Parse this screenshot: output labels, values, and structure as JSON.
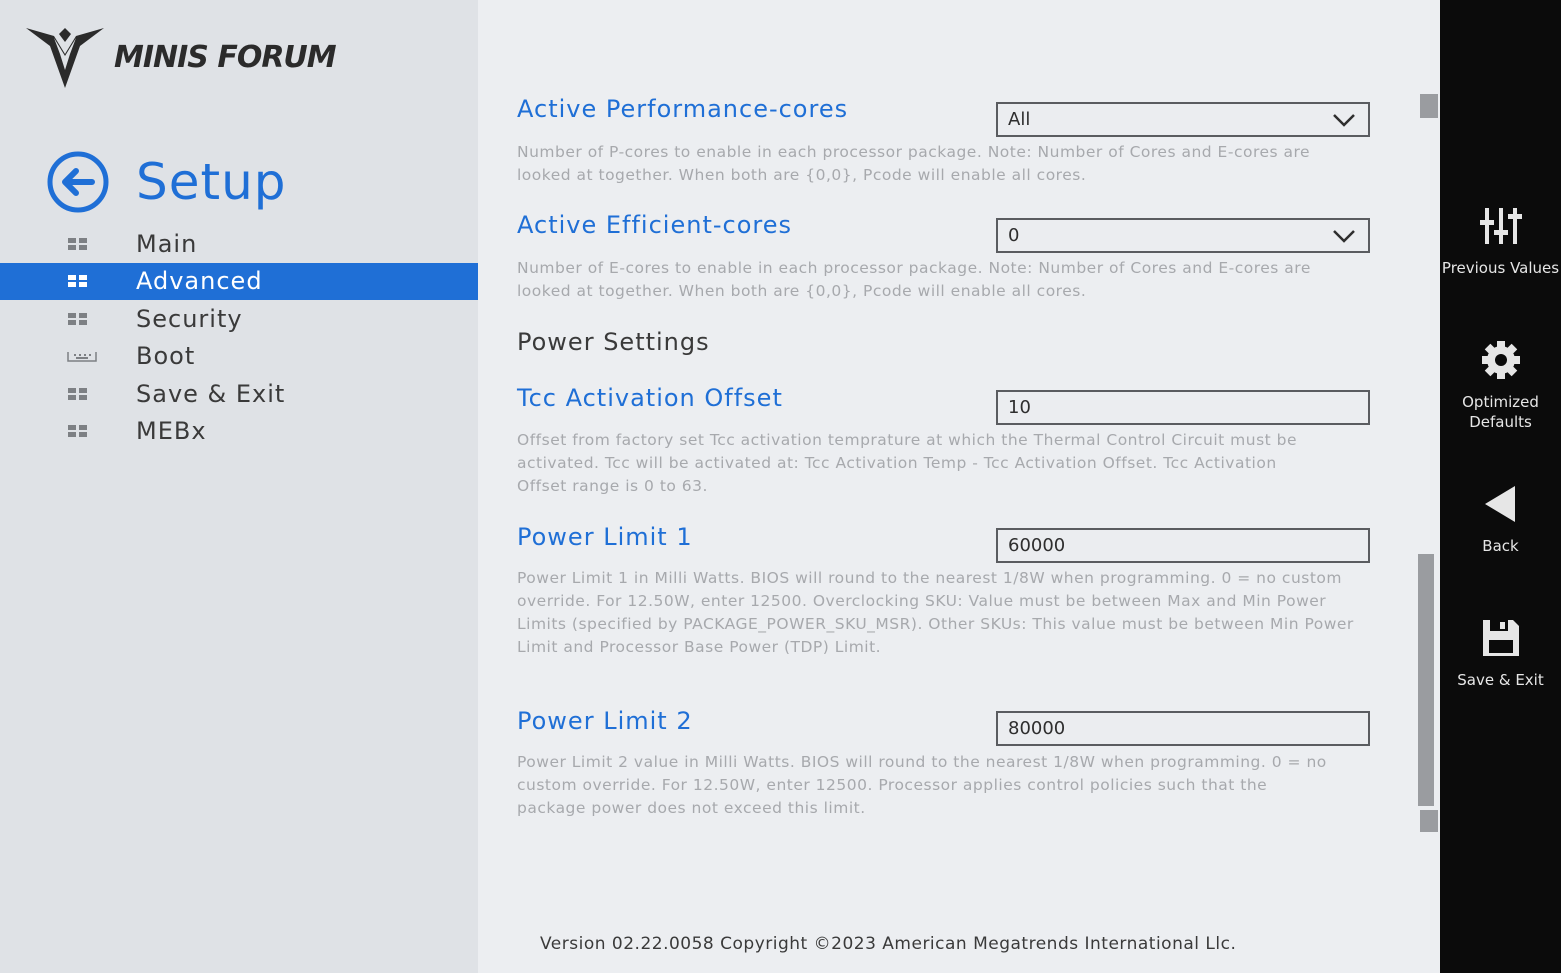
{
  "brand": {
    "logo_text": "MINIS FORUM"
  },
  "header": {
    "title": "Setup"
  },
  "sidebar": {
    "items": [
      {
        "label": "Main"
      },
      {
        "label": "Advanced"
      },
      {
        "label": "Security"
      },
      {
        "label": "Boot"
      },
      {
        "label": "Save & Exit"
      },
      {
        "label": "MEBx"
      }
    ],
    "selected": "Advanced"
  },
  "settings": {
    "p_cores": {
      "label": "Active Performance-cores",
      "value": "All",
      "help": "Number of P-cores to enable in each processor package. Note: Number of Cores and E-cores are looked at together. When both are {0,0}, Pcode will enable all cores."
    },
    "e_cores": {
      "label": "Active Efficient-cores",
      "value": "0",
      "help": "Number of E-cores to enable in each processor package. Note: Number of Cores and E-cores are looked at together. When both are {0,0}, Pcode will enable all cores."
    },
    "power_section": "Power Settings",
    "tcc": {
      "label": "Tcc Activation Offset",
      "value": "10",
      "help": "Offset from factory set Tcc activation temprature at which the Thermal Control Circuit must be activated. Tcc will be activated at: Tcc Activation Temp - Tcc Activation Offset. Tcc Activation Offset range is 0 to 63."
    },
    "pl1": {
      "label": "Power Limit 1",
      "value": "60000",
      "help": "Power Limit 1 in Milli Watts. BIOS will round to the nearest 1/8W when programming. 0 = no custom override. For 12.50W, enter 12500. Overclocking SKU: Value must be between Max and Min Power Limits (specified by PACKAGE_POWER_SKU_MSR). Other SKUs: This value must be between Min Power Limit and Processor Base Power (TDP) Limit."
    },
    "pl2": {
      "label": "Power Limit 2",
      "value": "80000",
      "help": "Power Limit 2 value in Milli Watts. BIOS will round to the nearest 1/8W when programming. 0 = no custom override. For 12.50W, enter 12500. Processor applies control policies such that the package power does not exceed this limit."
    }
  },
  "footer": {
    "version": "Version 02.22.0058 Copyright ©2023 American Megatrends International Llc."
  },
  "rightbar": {
    "previous_values": "Previous Values",
    "optimized_defaults": "Optimized Defaults",
    "back": "Back",
    "save_exit": "Save & Exit"
  },
  "colors": {
    "accent": "#1f6fd6",
    "panel": "#0b0b0b",
    "help_text": "#a7a9ad"
  },
  "icons": [
    "back-arrow-icon",
    "grid-icon",
    "keyboard-icon",
    "chevron-down-icon",
    "sliders-icon",
    "gear-icon",
    "back-triangle-icon",
    "floppy-disk-icon"
  ]
}
